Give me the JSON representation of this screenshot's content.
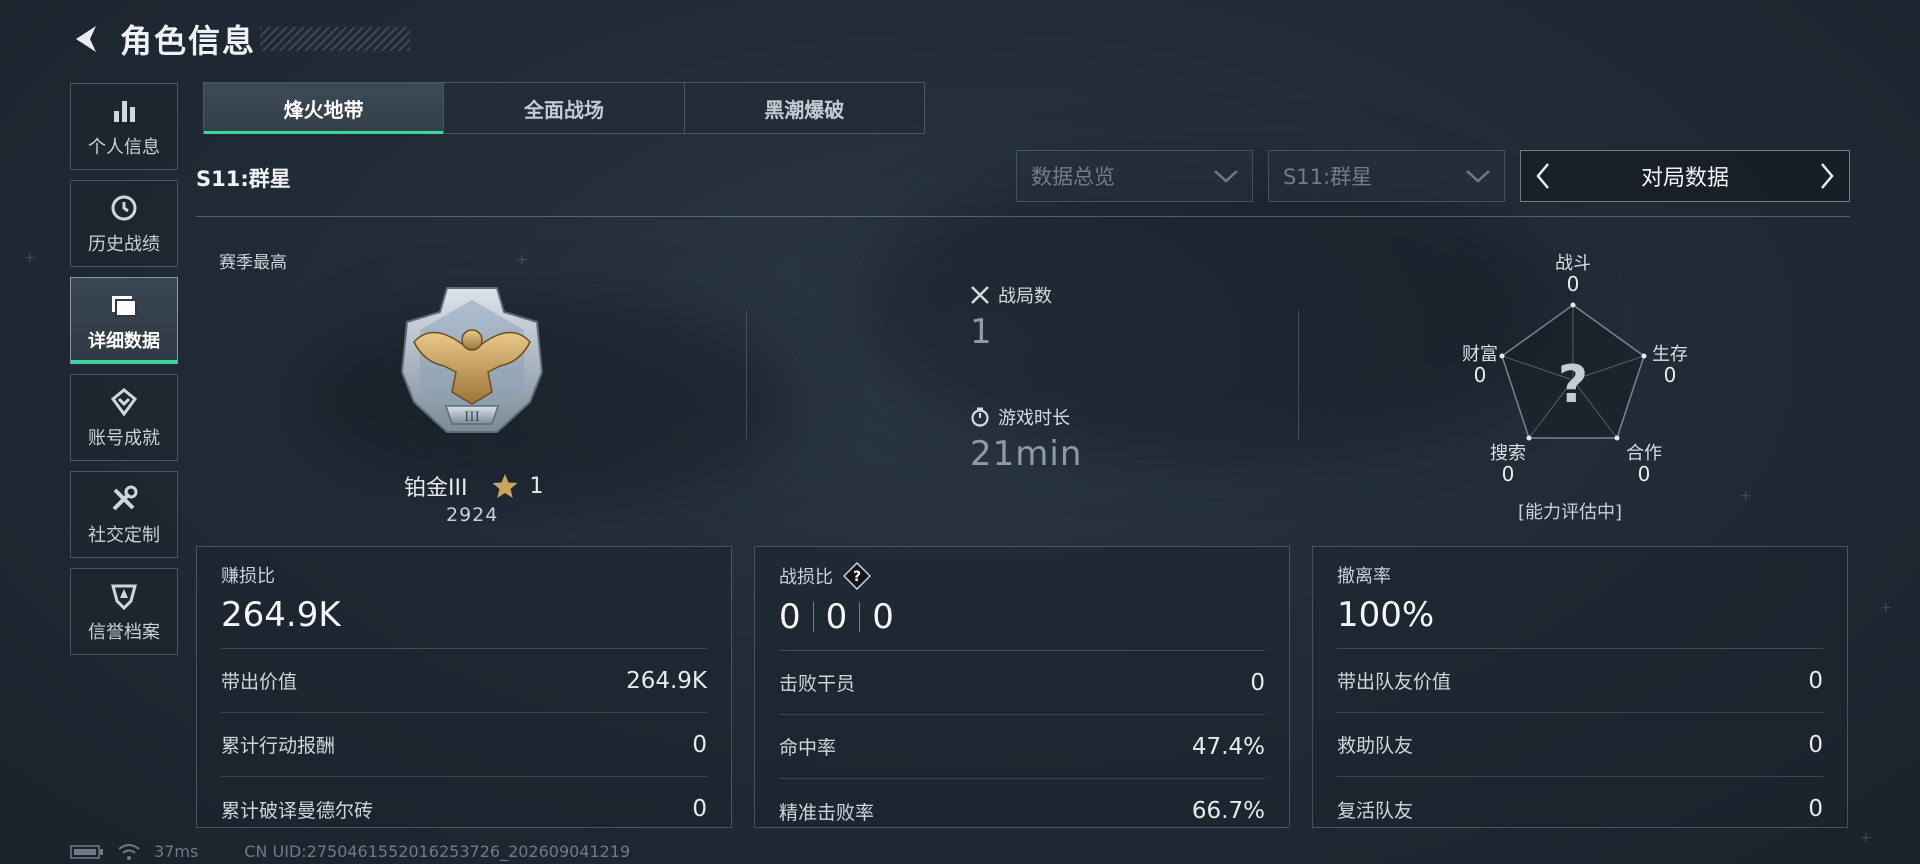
{
  "header": {
    "title": "角色信息"
  },
  "sidebar": {
    "items": [
      {
        "label": "个人信息",
        "icon": "bar-chart-icon"
      },
      {
        "label": "历史战绩",
        "icon": "history-clock-icon"
      },
      {
        "label": "详细数据",
        "icon": "folder-icon",
        "active": true
      },
      {
        "label": "账号成就",
        "icon": "achievement-icon"
      },
      {
        "label": "社交定制",
        "icon": "tools-icon"
      },
      {
        "label": "信誉档案",
        "icon": "shield-icon"
      }
    ]
  },
  "tabs": [
    {
      "label": "烽火地带",
      "active": true
    },
    {
      "label": "全面战场"
    },
    {
      "label": "黑潮爆破"
    }
  ],
  "season": {
    "label": "S11:群星",
    "filter_placeholder": "数据总览",
    "season_dropdown": "S11:群星",
    "pager_label": "对局数据"
  },
  "rank": {
    "heading": "赛季最高",
    "tier": "铂金III",
    "stars": "1",
    "score": "2924",
    "medal_numeral": "III"
  },
  "stats": {
    "matches_label": "战局数",
    "matches_value": "1",
    "playtime_label": "游戏时长",
    "playtime_value": "21min"
  },
  "radar": {
    "center_mark": "?",
    "combat": {
      "label": "战斗",
      "value": "0"
    },
    "survival": {
      "label": "生存",
      "value": "0"
    },
    "cooperation": {
      "label": "合作",
      "value": "0"
    },
    "search": {
      "label": "搜索",
      "value": "0"
    },
    "wealth": {
      "label": "财富",
      "value": "0"
    },
    "note": "[能力评估中]"
  },
  "cards": {
    "profit": {
      "title": "赚损比",
      "main": "264.9K",
      "rows": [
        {
          "label": "带出价值",
          "value": "264.9K"
        },
        {
          "label": "累计行动报酬",
          "value": "0"
        },
        {
          "label": "累计破译曼德尔砖",
          "value": "0"
        }
      ]
    },
    "combat": {
      "title": "战损比",
      "help": "?",
      "kd": [
        "0",
        "0",
        "0"
      ],
      "rows": [
        {
          "label": "击败干员",
          "value": "0"
        },
        {
          "label": "命中率",
          "value": "47.4%"
        },
        {
          "label": "精准击败率",
          "value": "66.7%"
        }
      ]
    },
    "extract": {
      "title": "撤离率",
      "main": "100%",
      "rows": [
        {
          "label": "带出队友价值",
          "value": "0"
        },
        {
          "label": "救助队友",
          "value": "0"
        },
        {
          "label": "复活队友",
          "value": "0"
        }
      ]
    }
  },
  "footer": {
    "ping": "37ms",
    "uid": "CN UID:2750461552016253726_202609041219"
  },
  "colors": {
    "accent": "#3ed49c",
    "background": "#222c37",
    "medal_gold": "#c9a45e"
  }
}
